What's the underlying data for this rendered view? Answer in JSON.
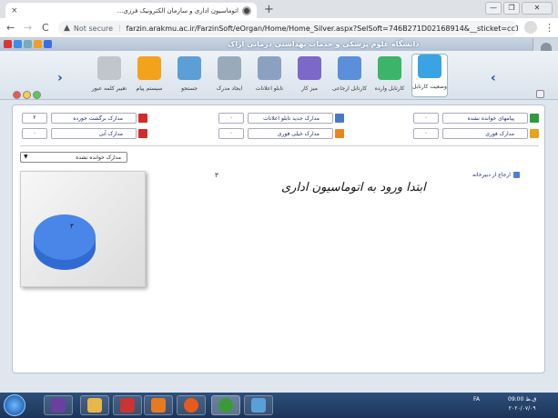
{
  "browser": {
    "tab_title": "اتوماسیون اداری و سازمان الکترونیک فرزی...",
    "tab_close": "×",
    "new_tab": "+",
    "back": "←",
    "forward": "→",
    "reload": "C",
    "not_secure": "Not secure",
    "url": "farzin.arakmu.ac.ir/FarzinSoft/eOrgan/Home/Home_Silver.aspx?SelSoft=746B271D02168914&__sticket=cc15...",
    "win_min": "—",
    "win_max": "❐",
    "win_close": "✕"
  },
  "app": {
    "org_title": "دانشگاه علوم پزشکی و خدمات بهداشتی درمانی اراک"
  },
  "toolbar": {
    "items": [
      {
        "label": "وضعیت کارتابل",
        "icon": "dashboard-chart-icon",
        "color": "#3aa3e3"
      },
      {
        "label": "کارتابل وارده",
        "icon": "inbox-tray-icon",
        "color": "#3cb56b"
      },
      {
        "label": "کارتابل ارجاعی",
        "icon": "referral-tray-icon",
        "color": "#5b8fd9"
      },
      {
        "label": "میز کار",
        "icon": "desk-grid-icon",
        "color": "#7b68c9"
      },
      {
        "label": "تابلو اعلانات",
        "icon": "bulletin-board-icon",
        "color": "#8aa2c0"
      },
      {
        "label": "ایجاد مدرک",
        "icon": "new-document-icon",
        "color": "#9ab"
      },
      {
        "label": "جستجو",
        "icon": "search-icon",
        "color": "#5c9fd6"
      },
      {
        "label": "سیستم پیام",
        "icon": "message-envelope-icon",
        "color": "#f3a21c"
      },
      {
        "label": "تغییر کلمه عبور",
        "icon": "password-keyboard-icon",
        "color": "#c0c6cc"
      }
    ]
  },
  "stats": {
    "row1": [
      {
        "label": "پیامهای خوانده نشده",
        "count": "۰",
        "icon": "envelope-icon",
        "color": "#2e9a3b"
      },
      {
        "label": "مدارک جدید تابلو اعلانات",
        "count": "۰",
        "icon": "board-icon",
        "color": "#4a78c7"
      },
      {
        "label": "مدارک برگشت خورده",
        "count": "۲",
        "icon": "return-arrow-icon",
        "color": "#d52a2a"
      }
    ],
    "row2": [
      {
        "label": "مدارک فوری",
        "count": "۰",
        "icon": "urgent-doc-icon",
        "color": "#e8a21c"
      },
      {
        "label": "مدارک خیلی فوری",
        "count": "۰",
        "icon": "very-urgent-doc-icon",
        "color": "#e8861c"
      },
      {
        "label": "مدارک آنی",
        "count": "۰",
        "icon": "instant-doc-icon",
        "color": "#d52a2a"
      }
    ]
  },
  "filter": {
    "selected": "مدارک خوانده نشده"
  },
  "chart_data": {
    "type": "pie",
    "total_label": "۳",
    "slices": [
      {
        "label": "ارجاع از دبیرخانه",
        "value": 3,
        "color": "#4a86e8"
      }
    ],
    "slice_labels": [
      "۳"
    ],
    "title": "ابتدا ورود به اتوماسیون اداری",
    "legend": "right"
  },
  "taskbar": {
    "lang": "FA",
    "time": "09:00 ق.ظ",
    "date": "۲۰۲۰/۰۷/۰۹"
  }
}
